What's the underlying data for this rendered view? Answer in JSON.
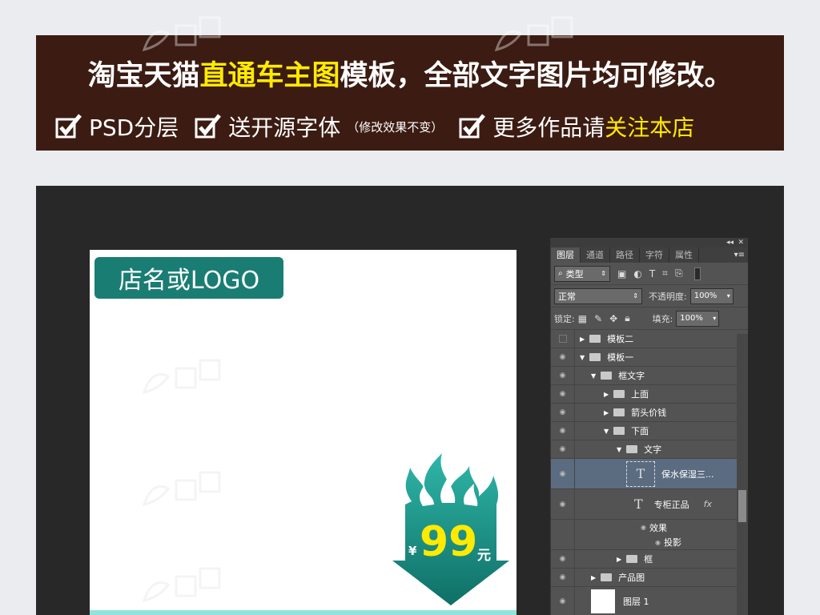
{
  "banner": {
    "title_part1": "淘宝天猫",
    "title_highlight": "直通车主图",
    "title_part2": "模板，全部文字图片均可修改。",
    "features": [
      {
        "text": "PSD分层"
      },
      {
        "text": "送开源字体",
        "note": "（修改效果不变）"
      },
      {
        "text_part1": "更多作品请",
        "text_highlight": "关注本店"
      }
    ]
  },
  "canvas": {
    "logo_text": "店名或LOGO",
    "price_yen": "¥",
    "price_value": "99",
    "price_unit": "元"
  },
  "panel": {
    "tabs": [
      "图层",
      "通道",
      "路径",
      "字符",
      "属性"
    ],
    "filter_label": "类型",
    "blend_mode": "正常",
    "opacity_label": "不透明度:",
    "opacity_value": "100%",
    "lock_label": "锁定:",
    "fill_label": "填充:",
    "fill_value": "100%",
    "layers": [
      {
        "name": "模板二",
        "type": "folder",
        "level": 0,
        "expanded": false
      },
      {
        "name": "模板一",
        "type": "folder",
        "level": 0,
        "expanded": true
      },
      {
        "name": "框文字",
        "type": "folder",
        "level": 1,
        "expanded": true
      },
      {
        "name": "上面",
        "type": "folder",
        "level": 2,
        "expanded": false
      },
      {
        "name": "箭头价钱",
        "type": "folder",
        "level": 2,
        "expanded": false
      },
      {
        "name": "下面",
        "type": "folder",
        "level": 2,
        "expanded": true
      },
      {
        "name": "文字",
        "type": "folder",
        "level": 3,
        "expanded": true
      },
      {
        "name": "保水保湿三...",
        "type": "text",
        "selected": true
      },
      {
        "name": "专柜正品",
        "type": "text",
        "fx": "fx"
      },
      {
        "name": "效果",
        "type": "effect"
      },
      {
        "name": "投影",
        "type": "effect"
      },
      {
        "name": "框",
        "type": "folder",
        "level": 3,
        "expanded": false
      },
      {
        "name": "产品图",
        "type": "folder",
        "level": 1,
        "expanded": false
      },
      {
        "name": "图层 1",
        "type": "image"
      }
    ]
  },
  "colors": {
    "banner_bg": "#3b1b12",
    "highlight": "#ffea00",
    "teal": "#1a7d73",
    "ps_bg": "#282828",
    "panel_bg": "#535353"
  }
}
